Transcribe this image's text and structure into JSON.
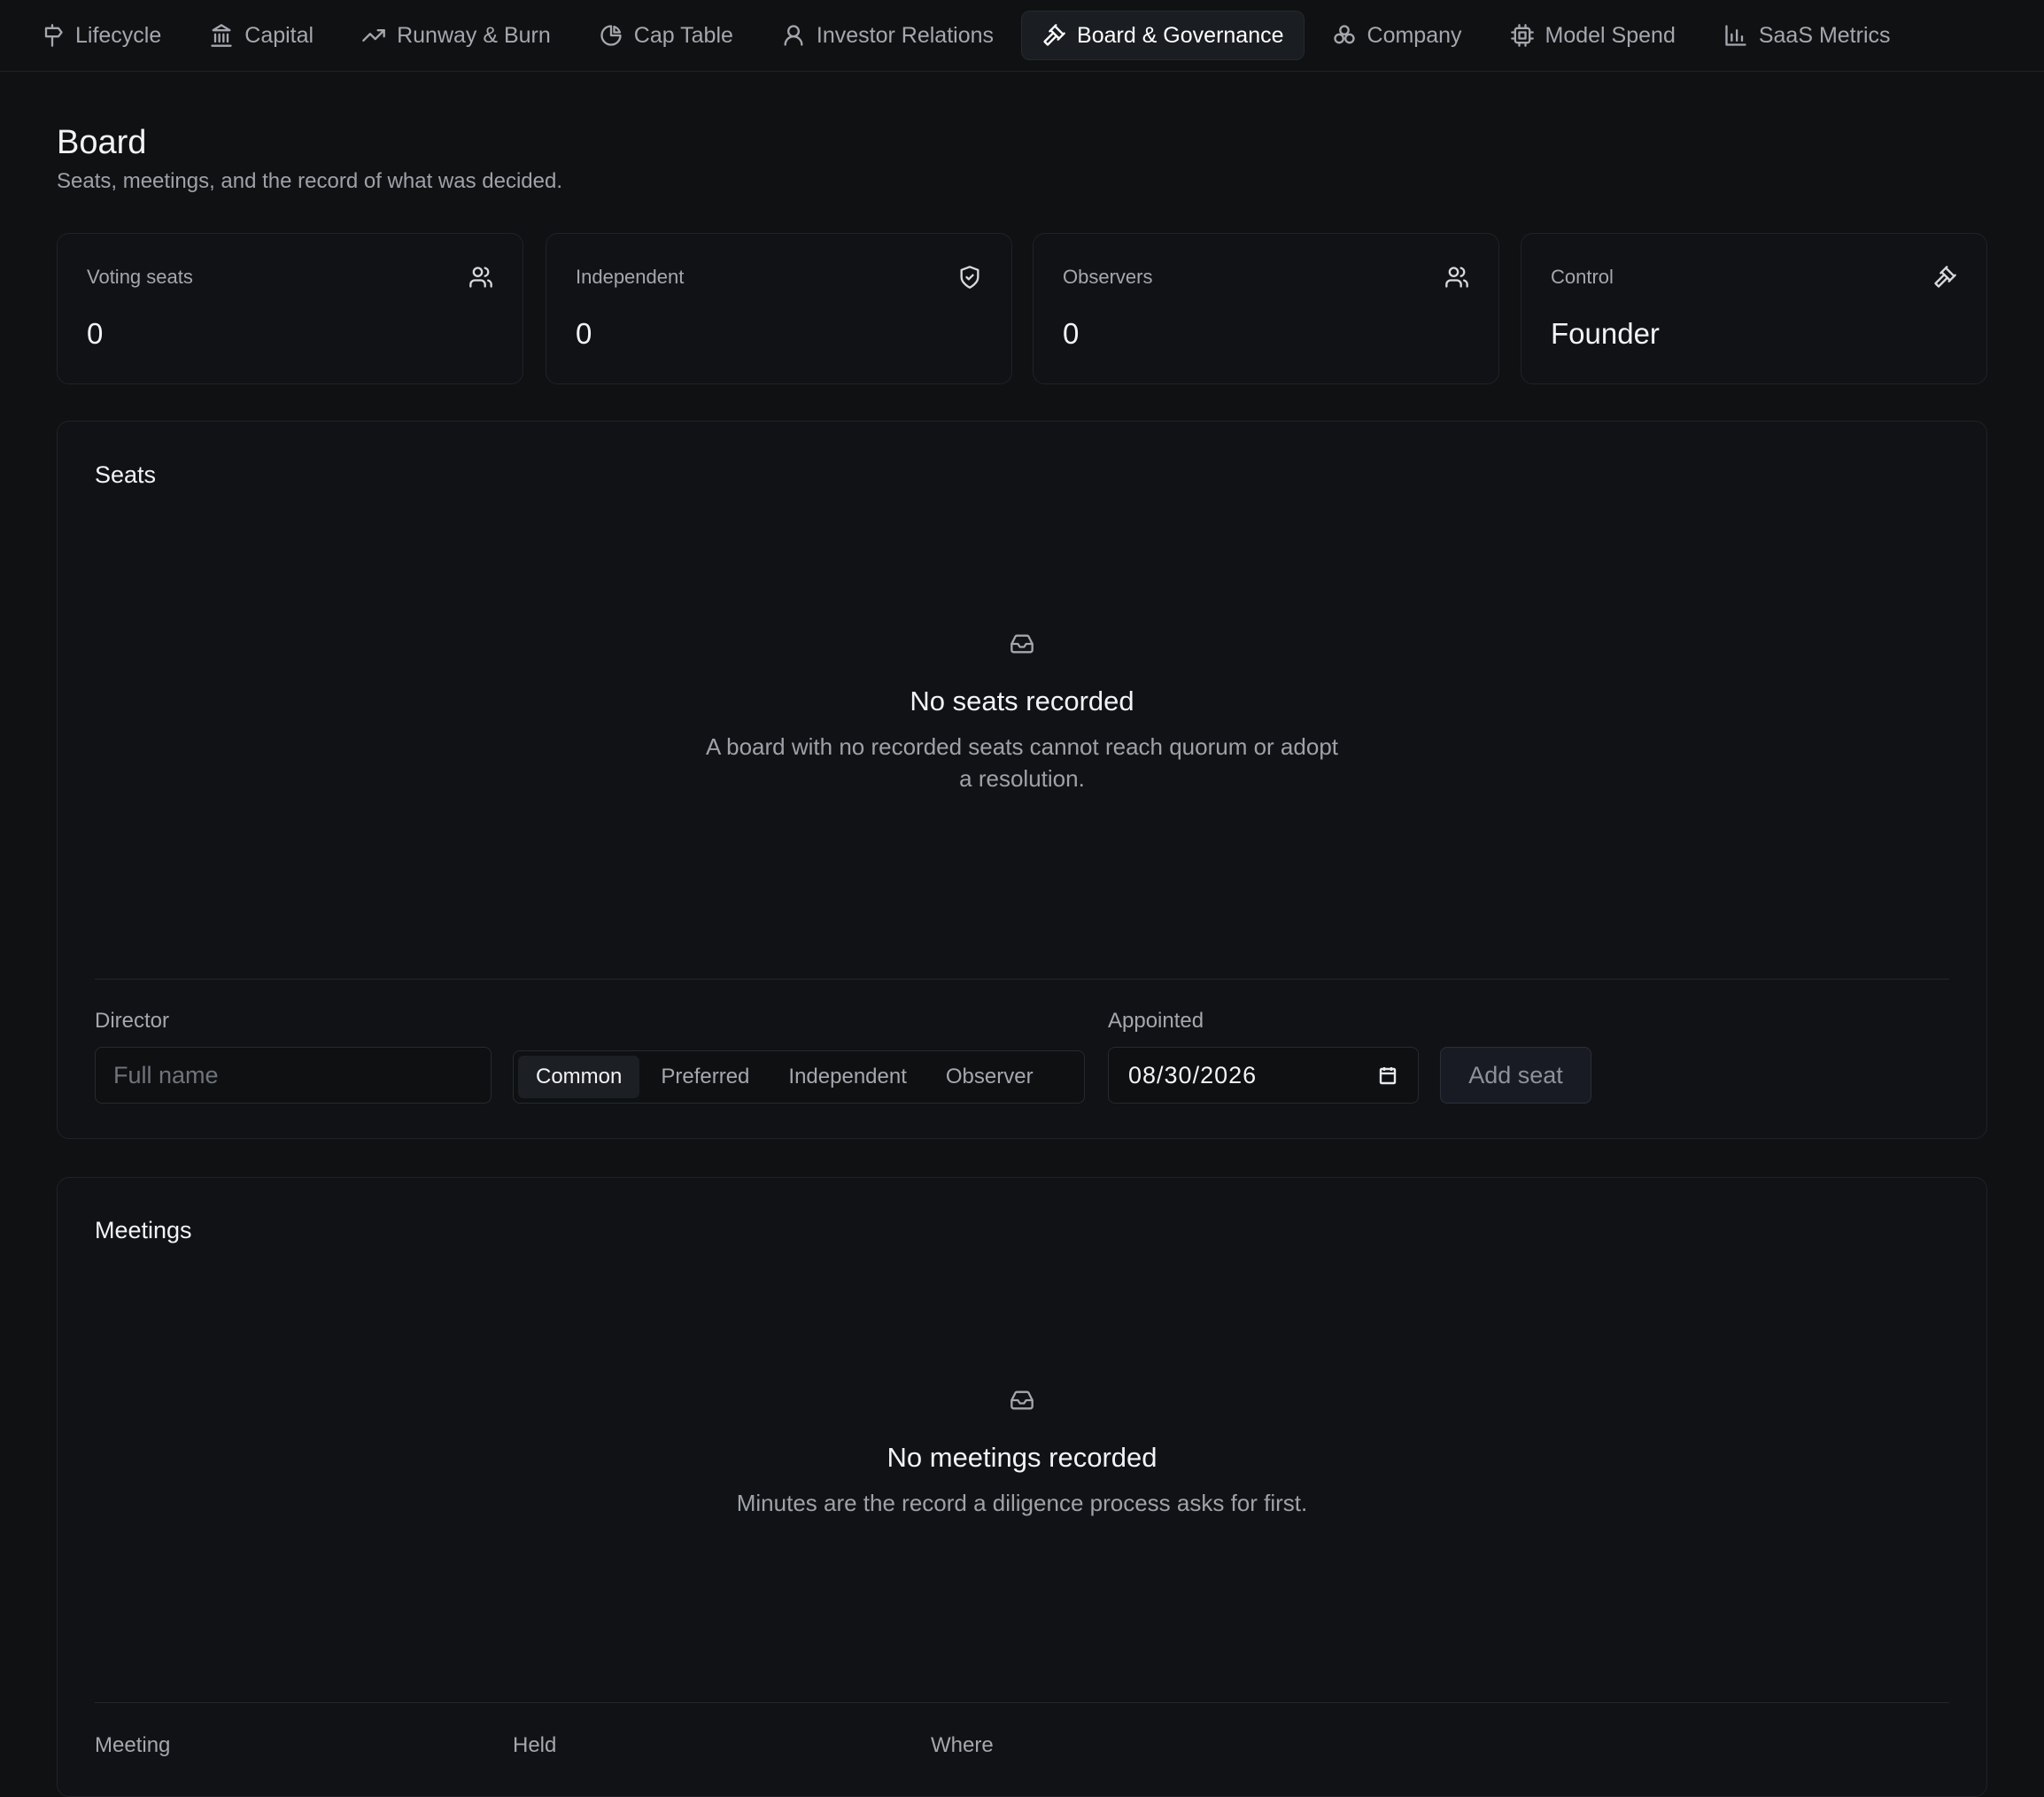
{
  "nav": {
    "tabs": [
      {
        "label": "Lifecycle",
        "icon": "signpost-icon"
      },
      {
        "label": "Capital",
        "icon": "bank-icon"
      },
      {
        "label": "Runway & Burn",
        "icon": "trending-up-icon"
      },
      {
        "label": "Cap Table",
        "icon": "pie-chart-icon"
      },
      {
        "label": "Investor Relations",
        "icon": "user-icon"
      },
      {
        "label": "Board & Governance",
        "icon": "gavel-icon",
        "active": true
      },
      {
        "label": "Company",
        "icon": "cluster-icon"
      },
      {
        "label": "Model Spend",
        "icon": "chip-icon"
      },
      {
        "label": "SaaS Metrics",
        "icon": "bar-chart-icon"
      }
    ]
  },
  "header": {
    "title": "Board",
    "subtitle": "Seats, meetings, and the record of what was decided."
  },
  "stats": [
    {
      "label": "Voting seats",
      "value": "0",
      "icon": "users-icon"
    },
    {
      "label": "Independent",
      "value": "0",
      "icon": "shield-check-icon"
    },
    {
      "label": "Observers",
      "value": "0",
      "icon": "users-icon"
    },
    {
      "label": "Control",
      "value": "Founder",
      "icon": "gavel-icon"
    }
  ],
  "seats": {
    "title": "Seats",
    "empty_title": "No seats recorded",
    "empty_text_line1": "A board with no recorded seats cannot reach quorum or adopt",
    "empty_text_line2": "a resolution.",
    "director_label": "Director",
    "director_placeholder": "Full name",
    "seat_types": [
      "Common",
      "Preferred",
      "Independent",
      "Observer"
    ],
    "selected_seat_type": "Common",
    "appointed_label": "Appointed",
    "appointed_value": "08/30/2026",
    "add_button": "Add seat"
  },
  "meetings": {
    "title": "Meetings",
    "empty_title": "No meetings recorded",
    "empty_text": "Minutes are the record a diligence process asks for first.",
    "columns": [
      "Meeting",
      "Held",
      "Where"
    ]
  },
  "colors": {
    "background": "#0f1113",
    "card": "#101215",
    "border": "#1f2327",
    "text": "#f2f3f5",
    "muted": "#a4a7ad"
  }
}
